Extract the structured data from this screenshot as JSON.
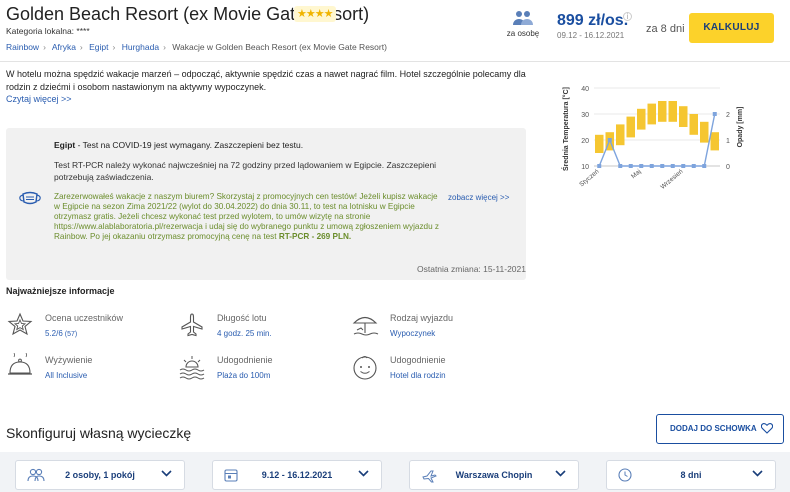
{
  "header": {
    "title": "Golden Beach Resort (ex Movie Gate Resort)",
    "stars": "★★★★",
    "category": "Kategoria lokalna: ****",
    "breadcrumbs": [
      "Rainbow",
      "Afryka",
      "Egipt",
      "Hurghada",
      "Wakacje w Golden Beach Resort (ex Movie Gate Resort)"
    ],
    "per_person_label": "za osobę",
    "price": "899 zł/os.",
    "price_dates": "09.12 - 16.12.2021",
    "days": "za 8 dni",
    "calc_button": "KALKULUJ"
  },
  "description": {
    "text": "W hotelu można spędzić wakacje marzeń – odpocząć, aktywnie spędzić czas a nawet nagrać film. Hotel szczególnie polecamy dla rodzin z dziećmi i osobom nastawionym na aktywny wypoczynek.",
    "more": "Czytaj więcej >>"
  },
  "covid": {
    "country": "Egipt",
    "line1": " - Test na COVID-19 jest wymagany. Zaszczepieni bez testu.",
    "line2": "Test RT-PCR należy wykonać najwcześniej na 72 godziny przed lądowaniem w Egipcie. Zaszczepieni potrzebują zaświadczenia.",
    "promo": "Zarezerwowałeś wakacje z naszym biurem? Skorzystaj z promocyjnych cen testów! Jeżeli kupisz wakacje w Egipcie na sezon Zima 2021/22 (wylot do 30.04.2022) do dnia 30.11, to test na lotnisku w Egipcie otrzymasz gratis. Jeżeli chcesz wykonać test przed wylotem, to umów wizytę na stronie https://www.alablaboratoria.pl/rezerwacja i udaj się do wybranego punktu z umową zgłoszeniem wyjazdu z Rainbow. Po jej okazaniu otrzymasz promocyjną cenę na test ",
    "promo_bold": "RT-PCR - 269 PLN.",
    "link": "zobacz więcej >>",
    "last_change": "Ostatnia zmiana: 15-11-2021"
  },
  "key_info": {
    "heading": "Najważniejsze informacje",
    "items": [
      {
        "label": "Ocena uczestników",
        "value": "5.2/6",
        "extra": " (57)",
        "icon": "star-badge-icon"
      },
      {
        "label": "Długość lotu",
        "value": "4 godz. 25 min.",
        "icon": "plane-icon"
      },
      {
        "label": "Rodzaj wyjazdu",
        "value": "Wypoczynek",
        "icon": "beach-umbrella-icon"
      },
      {
        "label": "Wyżywienie",
        "value": "All Inclusive",
        "icon": "food-cloche-icon"
      },
      {
        "label": "Udogodnienie",
        "value": "Plaża do 100m",
        "icon": "sea-sun-icon"
      },
      {
        "label": "Udogodnienie",
        "value": "Hotel dla rodzin",
        "icon": "child-face-icon"
      }
    ]
  },
  "configurator": {
    "title": "Skonfiguruj własną wycieczkę",
    "add_button": "DODAJ DO SCHOWKA",
    "selects": [
      {
        "value": "2 osoby, 1 pokój",
        "icon": "people-icon"
      },
      {
        "value": "9.12 - 16.12.2021",
        "icon": "calendar-icon"
      },
      {
        "value": "Warszawa Chopin",
        "icon": "plane-icon"
      },
      {
        "value": "8 dni",
        "icon": "clock-icon"
      }
    ]
  },
  "chart_data": {
    "type": "bar",
    "title": "",
    "ylabel": "Średnia Temperatura [°C]",
    "y2label": "Opady [mm]",
    "x_tick_labels": [
      "Styczeń",
      "Maj",
      "Wrzesień"
    ],
    "ylim": [
      10,
      40
    ],
    "y_ticks": [
      10,
      20,
      30,
      40
    ],
    "y2lim": [
      0,
      3
    ],
    "y2_ticks": [
      0,
      1,
      2
    ],
    "temperature_ranges": [
      [
        15,
        22
      ],
      [
        16,
        23
      ],
      [
        18,
        26
      ],
      [
        21,
        29
      ],
      [
        24,
        32
      ],
      [
        26,
        34
      ],
      [
        27,
        35
      ],
      [
        27,
        35
      ],
      [
        25,
        33
      ],
      [
        22,
        30
      ],
      [
        19,
        27
      ],
      [
        16,
        23
      ]
    ],
    "precipitation": [
      0,
      1,
      0,
      0,
      0,
      0,
      0,
      0,
      0,
      0,
      0,
      2
    ],
    "colors": {
      "bars": "#f5c631",
      "line": "#7ea4dd"
    },
    "grid": true
  }
}
